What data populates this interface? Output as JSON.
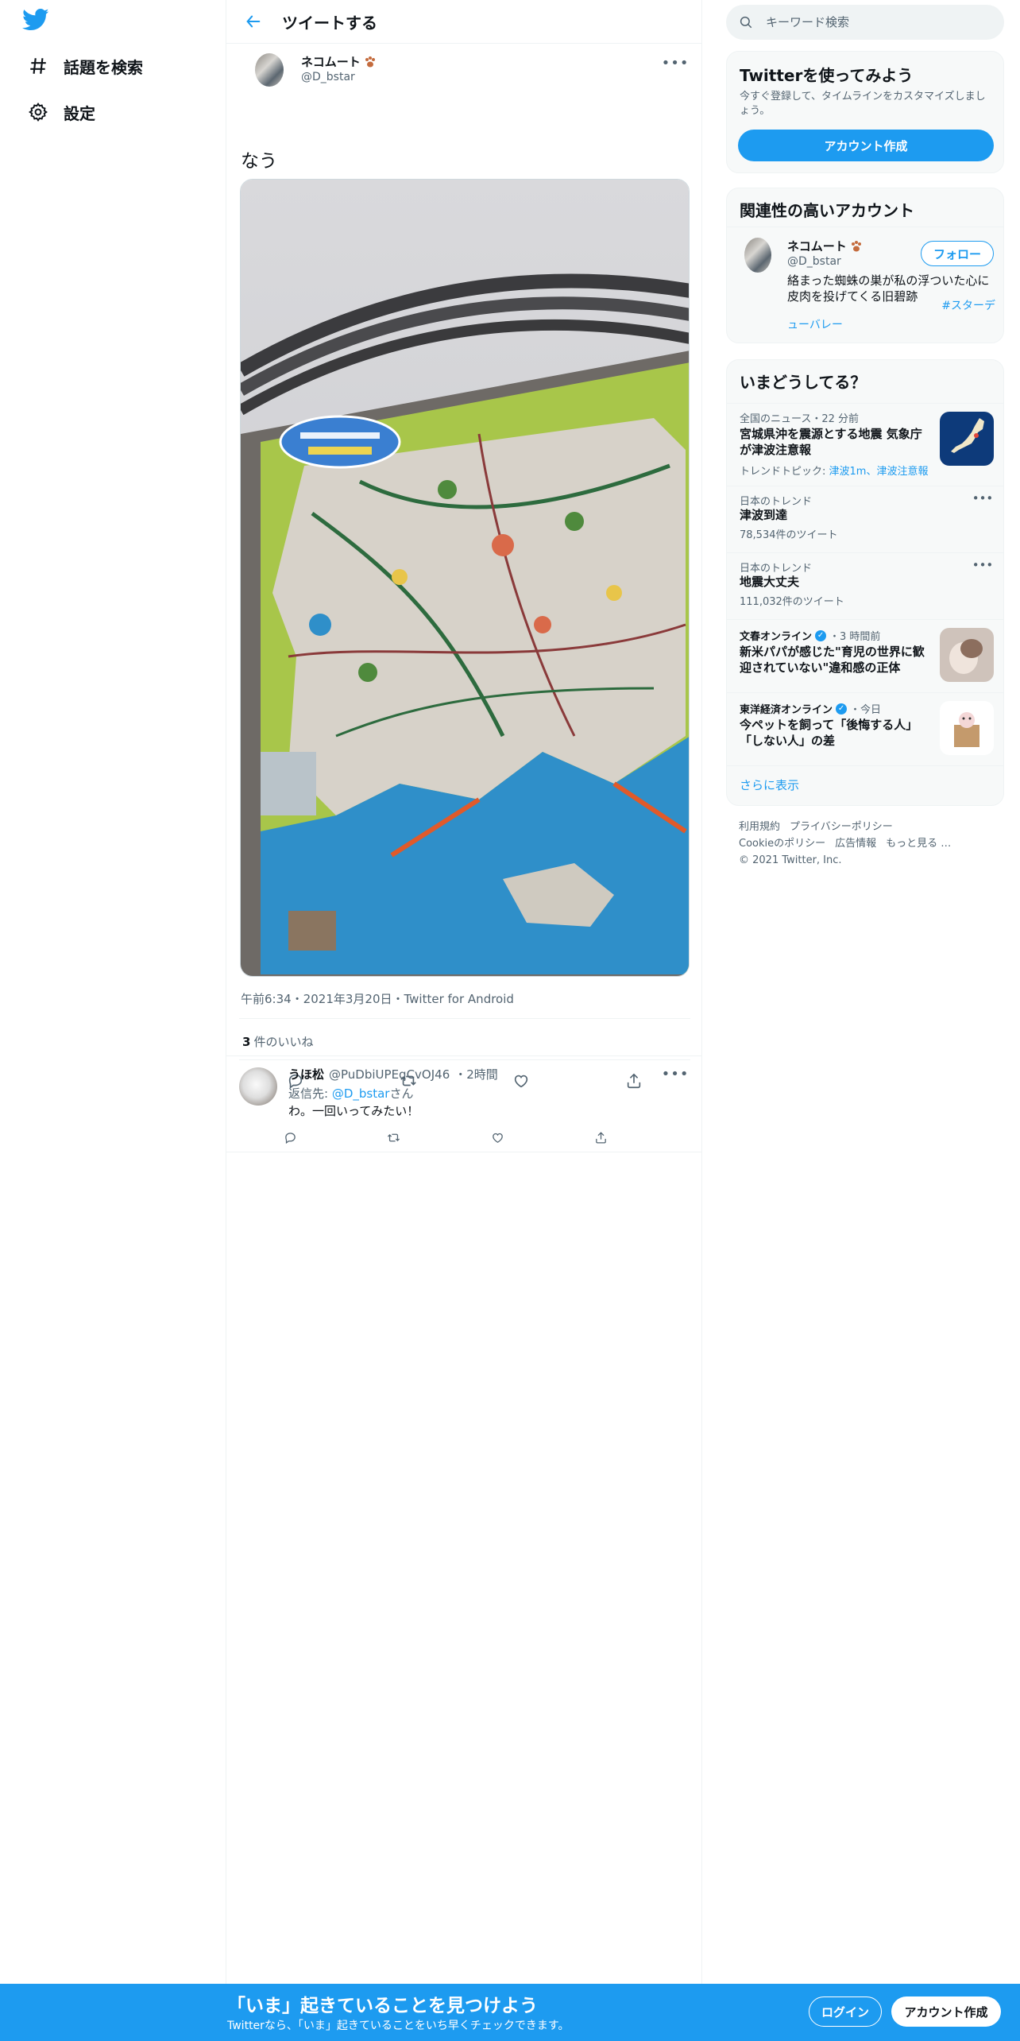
{
  "nav": {
    "explore_label": "話題を検索",
    "settings_label": "設定"
  },
  "header": {
    "title": "ツイートする"
  },
  "tweet": {
    "author_name": "ネコムート",
    "author_handle": "@D_bstar",
    "text": "なう",
    "meta": "午前6:34・2021年3月20日・Twitter for Android",
    "likes_count": "3",
    "likes_label": "件のいいね"
  },
  "reply": {
    "name": "うほ松",
    "handle": "@PuDbiUPEqCvOJ46",
    "time": "・2時間",
    "reply_to_prefix": "返信先: ",
    "reply_to_link": "@D_bstar",
    "reply_to_suffix": "さん",
    "text": "わ。一回いってみたい！"
  },
  "search": {
    "placeholder": "キーワード検索"
  },
  "try_card": {
    "title": "Twitterを使ってみよう",
    "desc": "今すぐ登録して、タイムラインをカスタマイズしましょう。",
    "button": "アカウント作成"
  },
  "relevant": {
    "title": "関連性の高いアカウント",
    "name": "ネコムート",
    "handle": "@D_bstar",
    "follow": "フォロー",
    "bio": "絡まった蜘蛛の巣が私の浮ついた心に皮肉を投げてくる旧碧跡",
    "bio_hashtag": "#スターデ",
    "bio_link": "ューバレー"
  },
  "trends": {
    "title": "いまどうしてる？",
    "items": [
      {
        "category": "全国のニュース・22 分前",
        "title": "宮城県沖を震源とする地震 気象庁が津波注意報",
        "topic_prefix": "トレンドトピック: ",
        "topic_links": "津波1m、津波注意報"
      },
      {
        "category": "日本のトレンド",
        "title": "津波到達",
        "count": "78,534件のツイート"
      },
      {
        "category": "日本のトレンド",
        "title": "地震大丈夫",
        "count": "111,032件のツイート"
      },
      {
        "source": "文春オンライン",
        "time": "・3 時間前",
        "title": "新米パパが感じた\"育児の世界に歓迎されていない\"違和感の正体"
      },
      {
        "source": "東洋経済オンライン",
        "time": "・今日",
        "title": "今ペットを飼って「後悔する人」「しない人」の差"
      }
    ],
    "show_more": "さらに表示"
  },
  "footer": {
    "links": [
      "利用規約",
      "プライバシーポリシー",
      "Cookieのポリシー",
      "広告情報",
      "もっと見る …"
    ],
    "copyright": "© 2021 Twitter, Inc."
  },
  "banner": {
    "title": "「いま」起きていることを見つけよう",
    "subtitle": "Twitterなら、「いま」起きていることをいち早くチェックできます。",
    "login": "ログイン",
    "signup": "アカウント作成"
  },
  "colors": {
    "accent": "#1d9bf0",
    "text": "#0f1419",
    "secondary": "#536471",
    "panel": "#f7f9f9"
  }
}
